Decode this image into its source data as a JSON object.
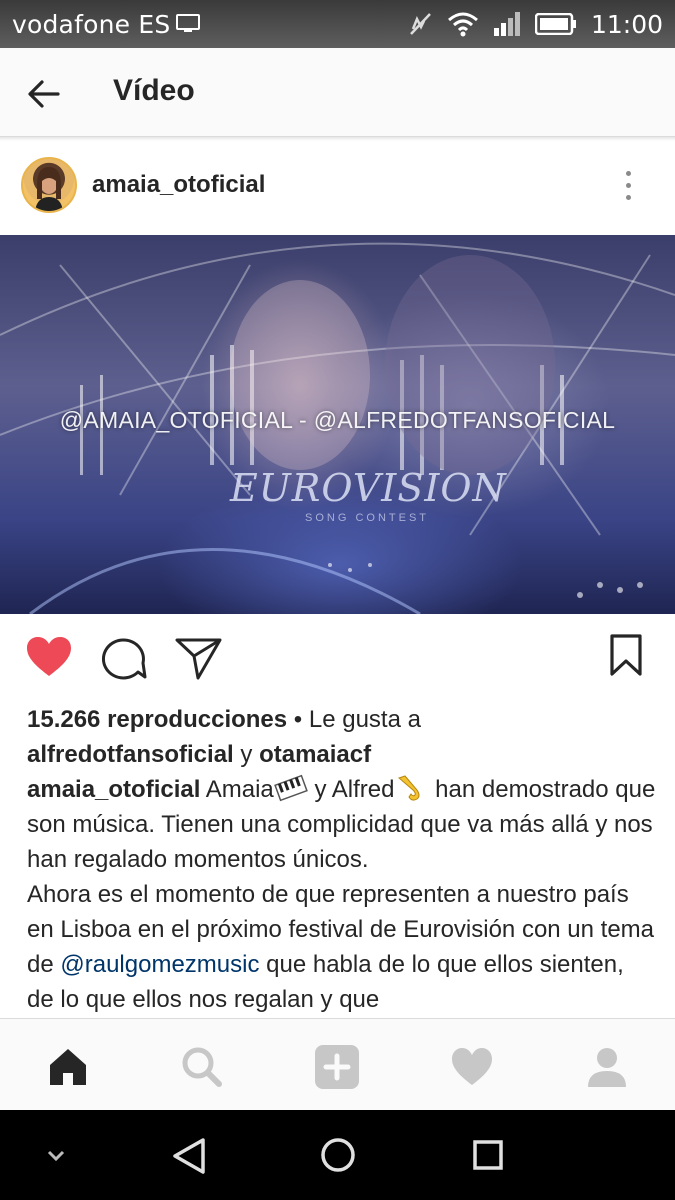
{
  "status_bar": {
    "carrier": "vodafone ES",
    "time": "11:00",
    "icons": [
      "screen-cast-icon",
      "vibrate-off-icon",
      "wifi-icon",
      "signal-icon",
      "battery-icon"
    ]
  },
  "header": {
    "back_icon": "arrow-left-icon",
    "title": "Vídeo"
  },
  "post": {
    "username": "amaia_otoficial",
    "more_icon": "more-vertical-icon",
    "video_overlay_text": "@AMAIA_OTOFICIAL - @ALFREDOTFANSOFICIAL",
    "video_logo": "EUROVISION",
    "video_logo_sub": "SONG CONTEST",
    "actions": {
      "like_icon": "heart-filled-icon",
      "comment_icon": "comment-icon",
      "share_icon": "send-icon",
      "save_icon": "bookmark-icon",
      "like_color": "#ed4956"
    },
    "views": "15.266 reproducciones",
    "liked_by_prefix": " • Le gusta a",
    "liked_by_user1": "alfredotfansoficial",
    "liked_by_and": " y ",
    "liked_by_user2": "otamaiacf",
    "caption_user": "amaia_otoficial",
    "caption_part1": " Amaia",
    "caption_part2": " y Alfred",
    "caption_part3": " han demostrado que son música. Tienen una complicidad que va más allá y nos han regalado momentos únicos.",
    "caption_part4": "Ahora es el momento de que representen a nuestro país en Lisboa en el próximo festival de Eurovisión con un tema de ",
    "caption_mention": "@raulgomezmusic",
    "caption_part5": " que habla de lo que ellos sienten, de lo que ellos nos regalan y que",
    "emoji1": "piano-keys-emoji",
    "emoji2": "saxophone-emoji"
  },
  "bottom_nav": [
    "home-icon",
    "search-icon",
    "add-icon",
    "activity-heart-icon",
    "profile-icon"
  ],
  "system_nav": [
    "collapse-chevron-icon",
    "back-triangle-icon",
    "home-circle-icon",
    "recents-square-icon"
  ]
}
